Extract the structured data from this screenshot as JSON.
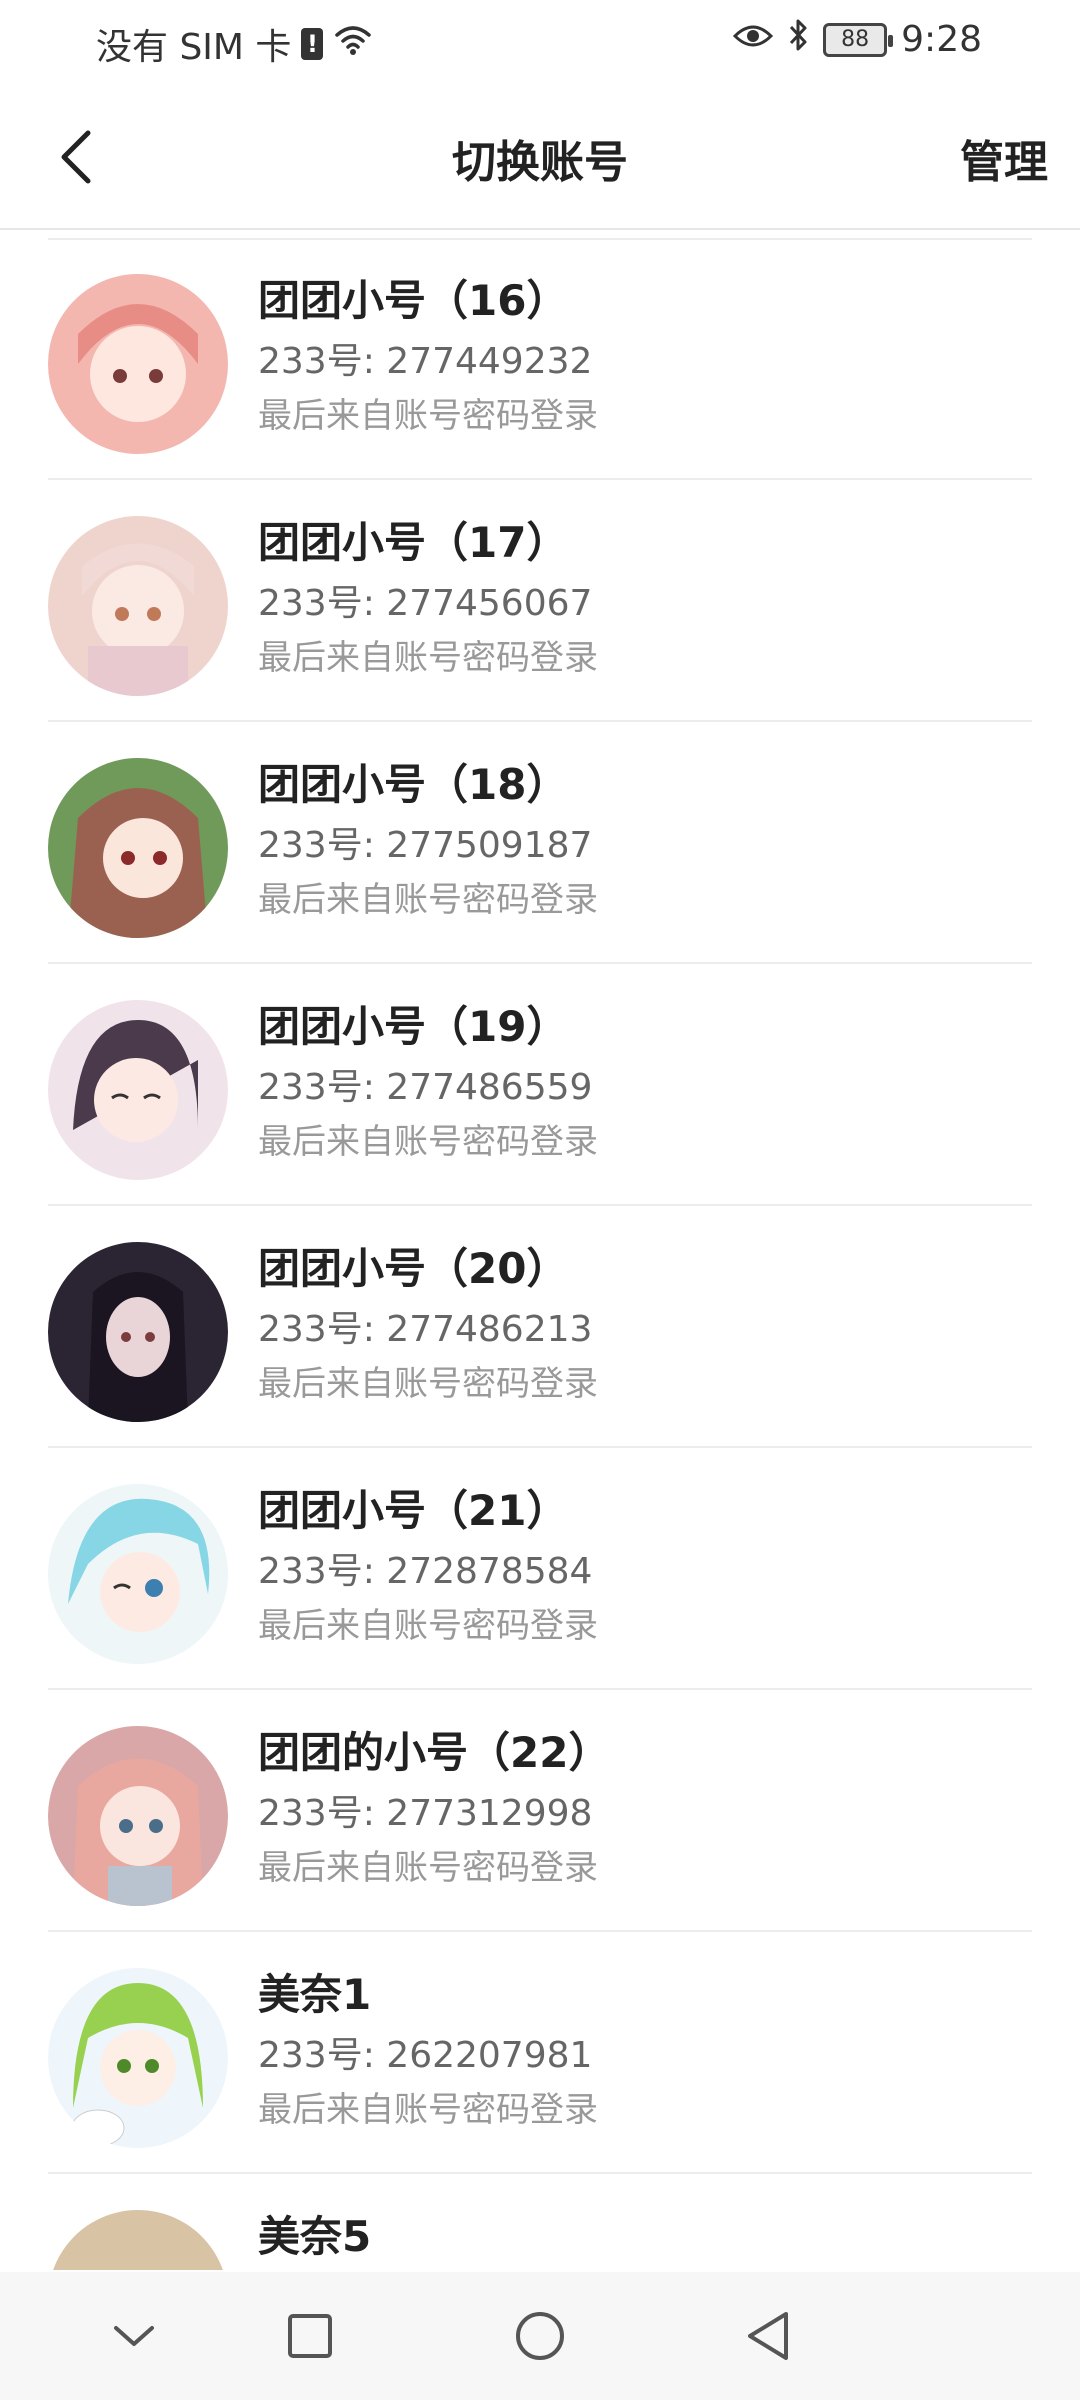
{
  "status_bar": {
    "carrier": "没有 SIM 卡",
    "alert": "!",
    "battery": "88",
    "time": "9:28"
  },
  "header": {
    "title": "切换账号",
    "manage_label": "管理"
  },
  "accounts": [
    {
      "name": "团团小号（16）",
      "uid": "233号: 277449232",
      "login": "最后来自账号密码登录",
      "color": "#f3b7b0"
    },
    {
      "name": "团团小号（17）",
      "uid": "233号: 277456067",
      "login": "最后来自账号密码登录",
      "color": "#efd4cd"
    },
    {
      "name": "团团小号（18）",
      "uid": "233号: 277509187",
      "login": "最后来自账号密码登录",
      "color": "#9b6150"
    },
    {
      "name": "团团小号（19）",
      "uid": "233号: 277486559",
      "login": "最后来自账号密码登录",
      "color": "#4a3a4c"
    },
    {
      "name": "团团小号（20）",
      "uid": "233号: 277486213",
      "login": "最后来自账号密码登录",
      "color": "#2b2433"
    },
    {
      "name": "团团小号（21）",
      "uid": "233号: 272878584",
      "login": "最后来自账号密码登录",
      "color": "#86d6e6"
    },
    {
      "name": "团团的小号（22）",
      "uid": "233号: 277312998",
      "login": "最后来自账号密码登录",
      "color": "#e9a89f"
    },
    {
      "name": "美奈1",
      "uid": "233号: 262207981",
      "login": "最后来自账号密码登录",
      "color": "#98d150"
    },
    {
      "name": "美奈5",
      "uid": "",
      "login": "",
      "color": "#d8c3a5"
    }
  ]
}
